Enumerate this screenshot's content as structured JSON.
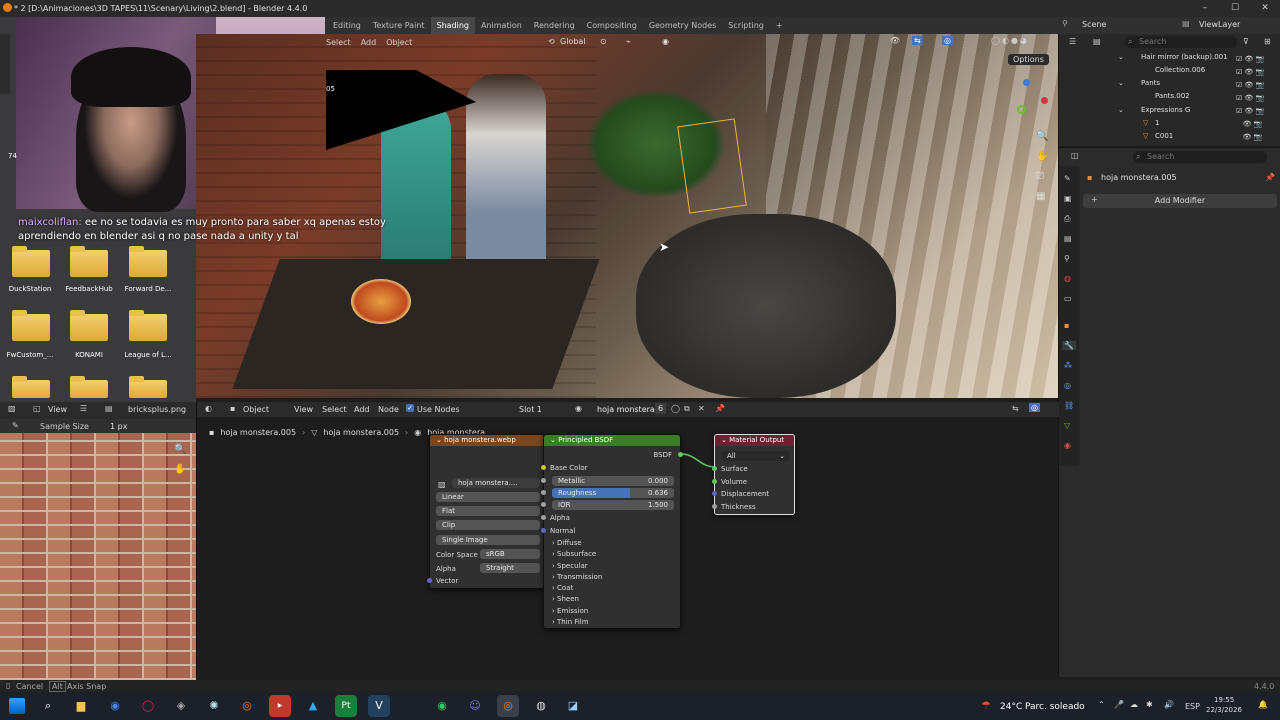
{
  "window": {
    "title": "* 2 [D:\\Animaciones\\3D TAPES\\11\\Scenary\\Living\\2.blend] - Blender 4.4.0"
  },
  "workspaces": [
    "Editing",
    "Texture Paint",
    "Shading",
    "Animation",
    "Rendering",
    "Compositing",
    "Geometry Nodes",
    "Scripting"
  ],
  "scene": {
    "label": "Scene",
    "view_layer": "ViewLayer"
  },
  "viewport": {
    "menu": [
      "Select",
      "Add",
      "Object"
    ],
    "transform": "Global",
    "options": "Options",
    "fragment": "05"
  },
  "chat": {
    "username": "maixcoliflan:",
    "message": "ee no se todavia es muy pronto para saber xq apenas estoy aprendiendo en blender asi q no pase nada a unity y tal"
  },
  "desktop_folders": [
    "DuckStation",
    "FeedbackHub",
    "Forward De...",
    "FwCustom_...",
    "KONAMI",
    "League of L..."
  ],
  "desktop_partial": [
    "74"
  ],
  "outliner": {
    "search": "Search",
    "rows": [
      {
        "label": "Hair mirror (backup).001"
      },
      {
        "label": "Collection.006"
      },
      {
        "label": "Pants"
      },
      {
        "label": "Pants.002"
      },
      {
        "label": "Expressions G"
      },
      {
        "label": "1"
      },
      {
        "label": "C001"
      }
    ]
  },
  "properties": {
    "search": "Search",
    "object": "hoja monstera.005",
    "add_modifier": "Add Modifier"
  },
  "image_editor": {
    "view": "View",
    "image": "bricksplus.png",
    "sample_label": "Sample Size",
    "sample_value": "1 px"
  },
  "node_editor": {
    "editor_type": "Object",
    "menu": [
      "View",
      "Select",
      "Add",
      "Node"
    ],
    "use_nodes": "Use Nodes",
    "slot": "Slot 1",
    "material": "hoja monstera",
    "users": "6",
    "breadcrumb": [
      "hoja monstera.005",
      "hoja monstera.005",
      "hoja monstera"
    ],
    "image_node": {
      "title": "hoja monstera.webp",
      "image": "hoja monstera....",
      "interpolation": "Linear",
      "projection": "Flat",
      "extension": "Clip",
      "source": "Single Image",
      "color_space_label": "Color Space",
      "color_space": "sRGB",
      "alpha_label": "Alpha",
      "alpha": "Straight",
      "vector": "Vector"
    },
    "bsdf_node": {
      "title": "Principled BSDF",
      "output": "BSDF",
      "base_color": "Base Color",
      "metallic": {
        "label": "Metallic",
        "value": "0.000"
      },
      "roughness": {
        "label": "Roughness",
        "value": "0.636",
        "fill": 0.636
      },
      "ior": {
        "label": "IOR",
        "value": "1.500"
      },
      "alpha": "Alpha",
      "normal": "Normal",
      "panels": [
        "Diffuse",
        "Subsurface",
        "Specular",
        "Transmission",
        "Coat",
        "Sheen",
        "Emission",
        "Thin Film"
      ]
    },
    "output_node": {
      "title": "Material Output",
      "target": "All",
      "inputs": [
        "Surface",
        "Volume",
        "Displacement",
        "Thickness"
      ]
    }
  },
  "statusbar": {
    "cancel": "Cancel",
    "key": "Alt",
    "axis_snap": "Axis Snap",
    "version": "4.4.0"
  },
  "taskbar": {
    "weather_temp": "24°C",
    "weather_text": "Parc. soleado",
    "lang": "ESP",
    "time": "19:55",
    "date": "22/3/2026",
    "icons": [
      "search-icon",
      "file-explorer-icon",
      "chrome-icon",
      "opera-icon",
      "app-icon",
      "blender-icon",
      "video-editor-icon",
      "photoshop-icon",
      "pt-icon",
      "visual-studio-icon",
      "spotify-icon",
      "discord-icon",
      "blender-active-icon",
      "obs-icon",
      "app-icon-2"
    ]
  },
  "colors": {
    "accent": "#4772b3",
    "active_tab": "#474747",
    "node_texture_header": "#79461d",
    "node_shader_header": "#3a7e27",
    "node_output_header": "#6a2232"
  }
}
